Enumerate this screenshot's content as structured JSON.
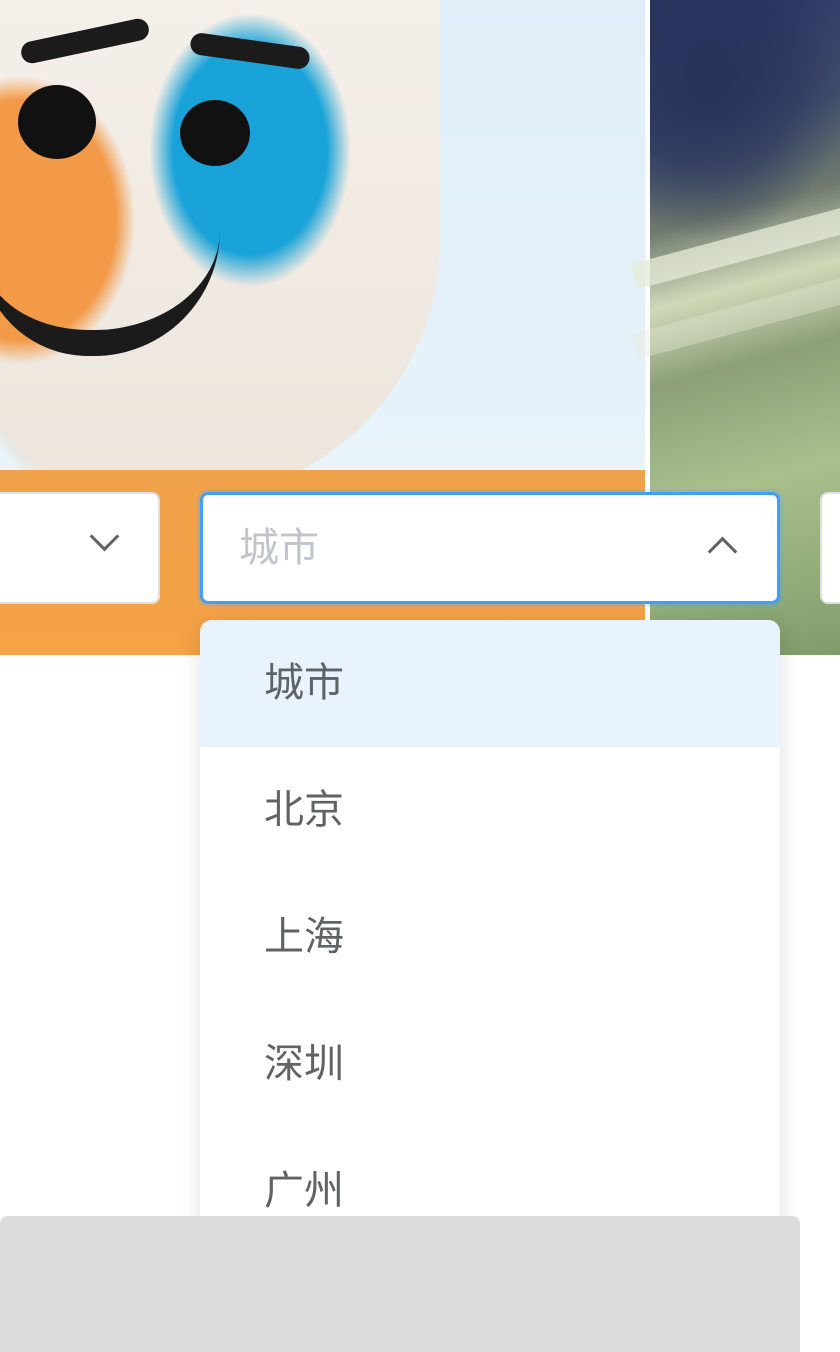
{
  "city_select": {
    "placeholder": "城市",
    "options": [
      {
        "label": "城市",
        "selected": true
      },
      {
        "label": "北京",
        "selected": false
      },
      {
        "label": "上海",
        "selected": false
      },
      {
        "label": "深圳",
        "selected": false
      },
      {
        "label": "广州",
        "selected": false
      }
    ]
  },
  "colors": {
    "accent": "#409eff",
    "option_hover_bg": "#e8f3fd",
    "placeholder_text": "#c0c4cc",
    "option_text": "#606266",
    "bottom_bar": "#dcdcdc"
  },
  "icons": {
    "left_select_arrow": "chevron-down-icon",
    "city_select_arrow": "chevron-up-icon"
  }
}
